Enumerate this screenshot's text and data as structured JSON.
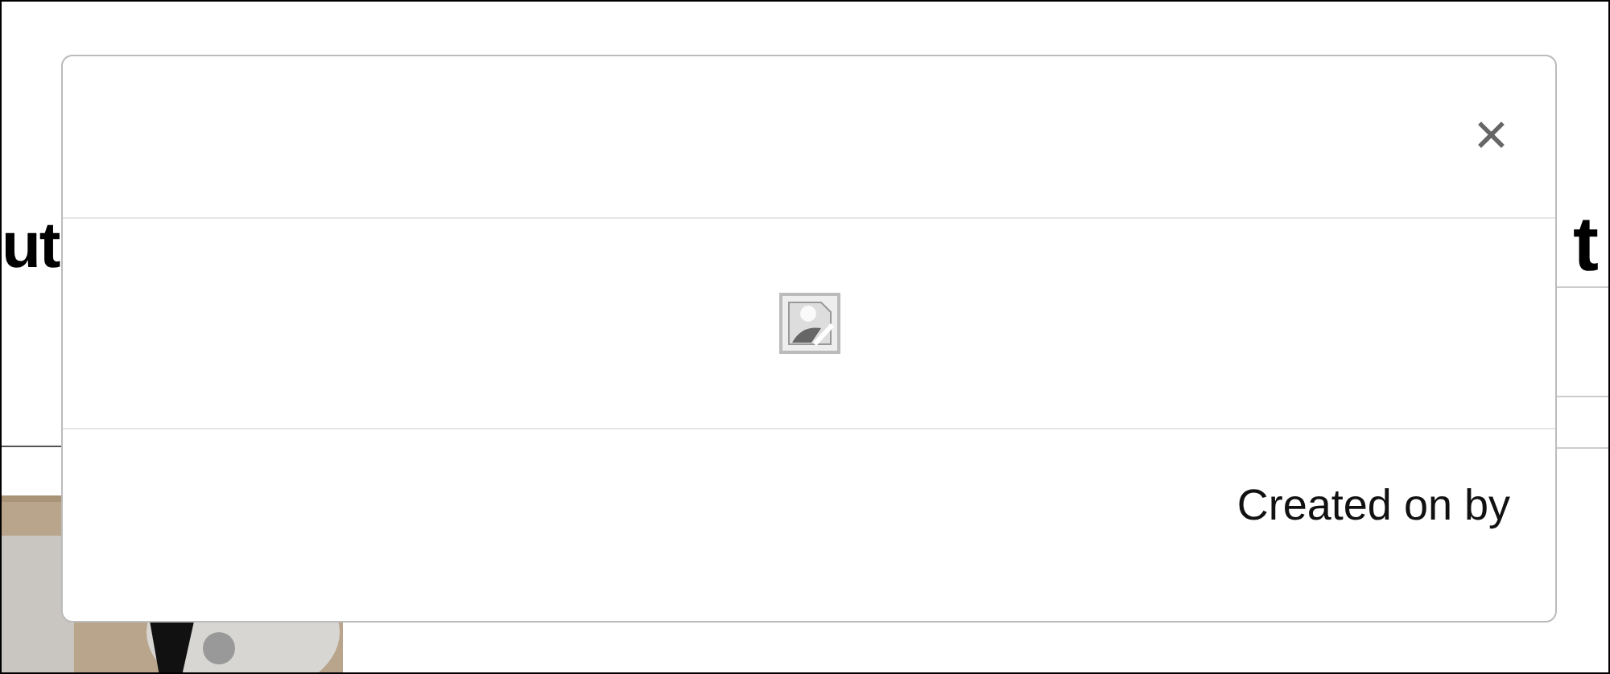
{
  "page": {
    "heading_left": "ut",
    "heading_right": "t"
  },
  "modal": {
    "close": "✕",
    "footer_text": "Created on by"
  }
}
